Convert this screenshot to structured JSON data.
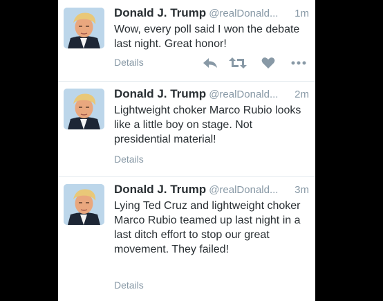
{
  "tweets": [
    {
      "name": "Donald J. Trump",
      "handle": "@realDonald...",
      "time": "1m",
      "text": "Wow, every poll said I won the debate last night. Great honor!",
      "details": "Details",
      "actions": [
        "reply-icon",
        "retweet-icon",
        "like-icon",
        "more-icon"
      ]
    },
    {
      "name": "Donald J. Trump",
      "handle": "@realDonald...",
      "time": "2m",
      "text": "Lightweight choker Marco Rubio looks like a little boy on stage. Not presidential material!",
      "details": "Details"
    },
    {
      "name": "Donald J. Trump",
      "handle": "@realDonald...",
      "time": "3m",
      "text": "Lying Ted Cruz and lightweight choker  Marco Rubio teamed up last night in a last ditch effort to stop our great movement. They failed!",
      "details": "Details"
    }
  ],
  "colors": {
    "background": "#000000",
    "panel": "#ffffff",
    "name": "#292f33",
    "meta": "#8899a6",
    "action_icon": "#8899a6"
  }
}
